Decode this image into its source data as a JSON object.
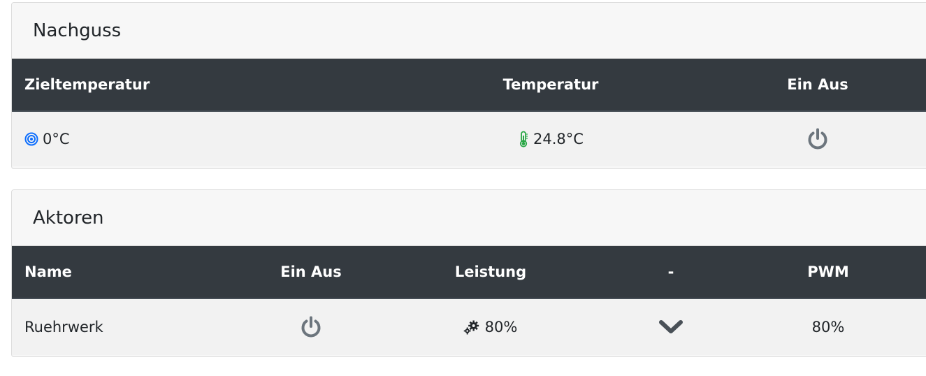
{
  "nachguss": {
    "title": "Nachguss",
    "columns": {
      "target": "Zieltemperatur",
      "temperature": "Temperatur",
      "onoff": "Ein Aus"
    },
    "row": {
      "target_value": "0°C",
      "temperature_value": "24.8°C",
      "target_icon": "target-icon",
      "temperature_icon": "thermometer-icon",
      "power_icon": "power-icon"
    }
  },
  "aktoren": {
    "title": "Aktoren",
    "columns": {
      "name": "Name",
      "onoff": "Ein Aus",
      "power": "Leistung",
      "dash": "-",
      "pwm": "PWM"
    },
    "row": {
      "name": "Ruehrwerk",
      "power_value": "80%",
      "pwm_value": "80%",
      "power_icon": "power-icon",
      "gears_icon": "gears-icon",
      "chevron_icon": "chevron-down-icon"
    }
  },
  "colors": {
    "header_dark": "#343a40",
    "target_icon": "#0d6efd",
    "thermometer_icon": "#28a745",
    "icon_gray": "#6c757d"
  }
}
